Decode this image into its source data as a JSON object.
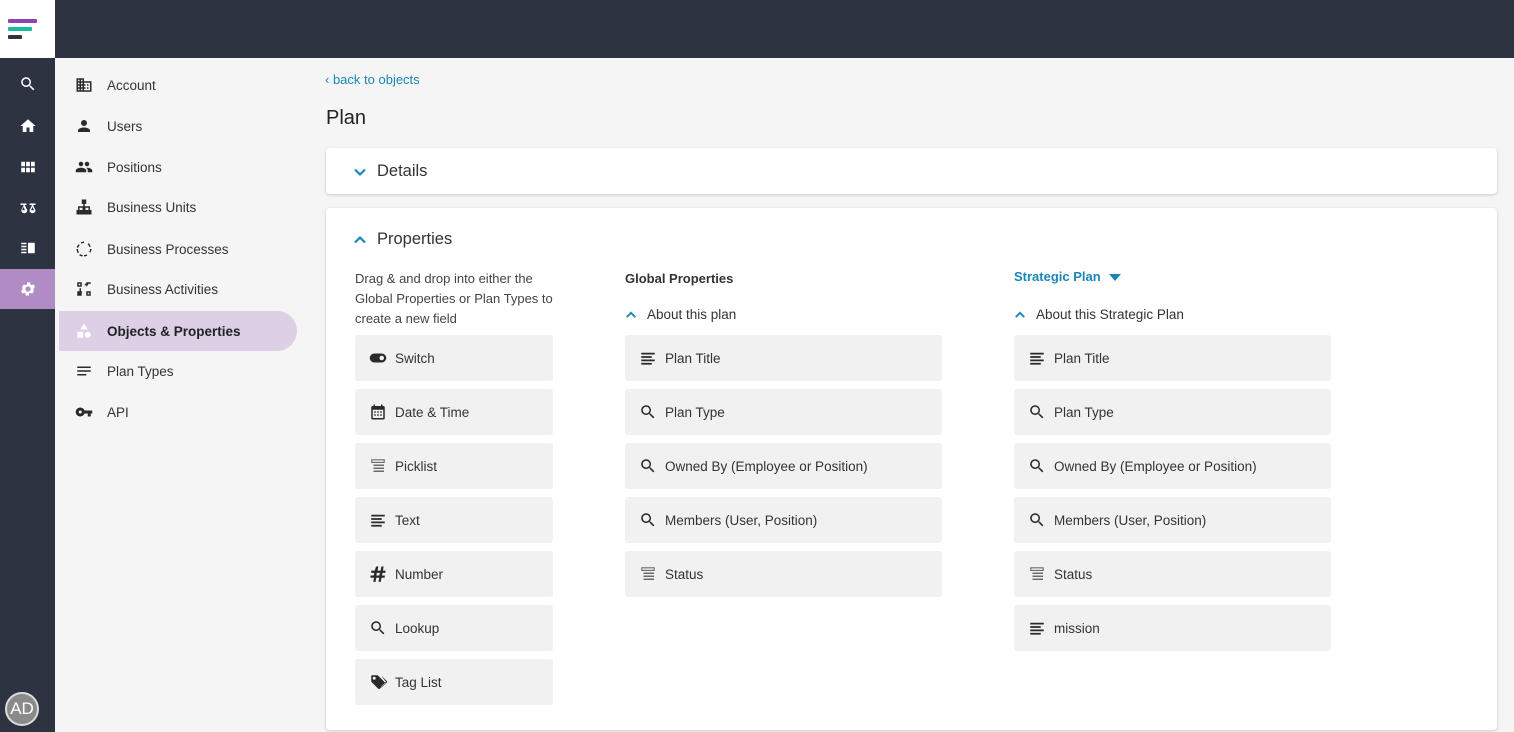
{
  "colors": {
    "topbar": "#2d3340",
    "rail_active": "#b08cc4",
    "nav_active": "#dccfe6",
    "accent": "#1a86b8",
    "logo": [
      "#8e44ad",
      "#1abc9c",
      "#2d3340"
    ]
  },
  "rail": {
    "icons": [
      "search-icon",
      "home-icon",
      "apps-grid-icon",
      "scales-icon",
      "board-icon",
      "gear-icon"
    ],
    "avatar_initials": "AD"
  },
  "nav": {
    "items": [
      {
        "label": "Account",
        "icon": "building-icon"
      },
      {
        "label": "Users",
        "icon": "person-icon"
      },
      {
        "label": "Positions",
        "icon": "people-icon"
      },
      {
        "label": "Business Units",
        "icon": "org-chart-icon"
      },
      {
        "label": "Business Processes",
        "icon": "cycle-icon"
      },
      {
        "label": "Business Activities",
        "icon": "activities-icon"
      },
      {
        "label": "Objects & Properties",
        "icon": "shapes-icon",
        "active": true
      },
      {
        "label": "Plan Types",
        "icon": "lines-icon"
      },
      {
        "label": "API",
        "icon": "key-icon"
      }
    ]
  },
  "main": {
    "back_link": "back to objects",
    "page_title": "Plan",
    "details": {
      "label": "Details"
    },
    "properties": {
      "label": "Properties",
      "instructions": "Drag & and drop into either the Global Properties or Plan Types to create a new field",
      "field_types": [
        {
          "label": "Switch",
          "icon": "toggle-icon"
        },
        {
          "label": "Date & Time",
          "icon": "calendar-icon"
        },
        {
          "label": "Picklist",
          "icon": "picklist-icon"
        },
        {
          "label": "Text",
          "icon": "text-lines-icon"
        },
        {
          "label": "Number",
          "icon": "hash-icon"
        },
        {
          "label": "Lookup",
          "icon": "search-icon"
        },
        {
          "label": "Tag List",
          "icon": "tag-icon"
        }
      ],
      "global": {
        "heading": "Global Properties",
        "group_label": "About this plan",
        "fields": [
          {
            "label": "Plan Title",
            "icon": "text-lines-icon"
          },
          {
            "label": "Plan Type",
            "icon": "search-icon"
          },
          {
            "label": "Owned By (Employee or Position)",
            "icon": "search-icon"
          },
          {
            "label": "Members (User, Position)",
            "icon": "search-icon"
          },
          {
            "label": "Status",
            "icon": "picklist-icon"
          }
        ]
      },
      "plan_type": {
        "selected": "Strategic Plan",
        "group_label": "About this Strategic Plan",
        "fields": [
          {
            "label": "Plan Title",
            "icon": "text-lines-icon"
          },
          {
            "label": "Plan Type",
            "icon": "search-icon"
          },
          {
            "label": "Owned By (Employee or Position)",
            "icon": "search-icon"
          },
          {
            "label": "Members (User, Position)",
            "icon": "search-icon"
          },
          {
            "label": "Status",
            "icon": "picklist-icon"
          },
          {
            "label": "mission",
            "icon": "text-lines-icon"
          }
        ]
      }
    }
  }
}
